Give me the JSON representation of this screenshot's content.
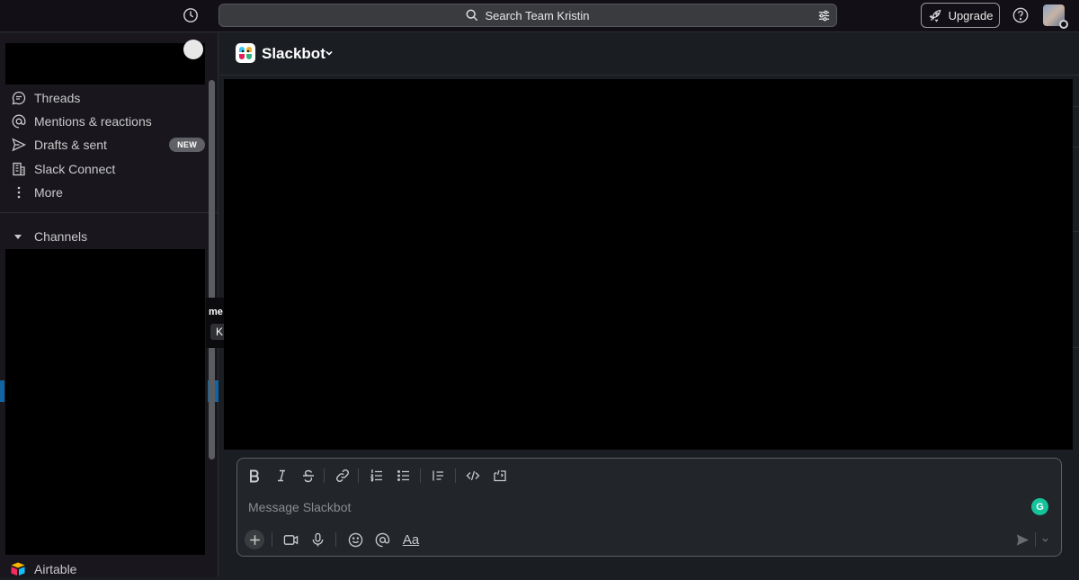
{
  "topbar": {
    "search_placeholder": "Search Team Kristin",
    "upgrade_label": "Upgrade"
  },
  "sidebar": {
    "nav": [
      {
        "label": "Threads",
        "icon": "threads-icon"
      },
      {
        "label": "Mentions & reactions",
        "icon": "at-sign-icon"
      },
      {
        "label": "Drafts & sent",
        "icon": "send-icon",
        "badge": "NEW"
      },
      {
        "label": "Slack Connect",
        "icon": "building-icon"
      },
      {
        "label": "More",
        "icon": "more-vertical-icon"
      }
    ],
    "channels_label": "Channels",
    "tooltip_text": "me",
    "tooltip_key": "K",
    "app_item": "Airtable"
  },
  "channel": {
    "name": "Slackbot"
  },
  "composer": {
    "placeholder": "Message Slackbot",
    "font_button": "Aa",
    "grammarly_letter": "G"
  },
  "colors": {
    "accent_blue": "#1164a3",
    "grammarly_green": "#15c39a",
    "background": "#1a1d21"
  }
}
